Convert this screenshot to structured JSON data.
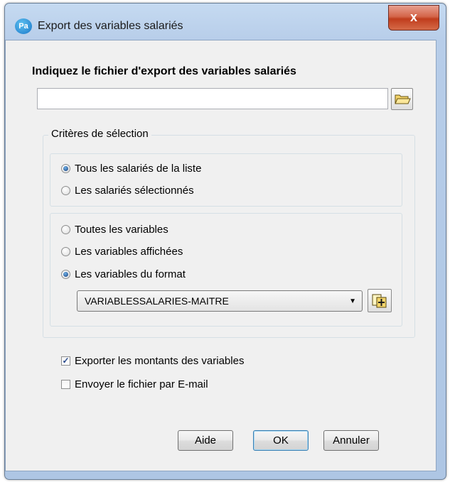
{
  "window": {
    "title": "Export des variables salariés",
    "app_icon_text": "Pa",
    "close_label": "x"
  },
  "file_section": {
    "heading": "Indiquez le fichier d'export des variables salariés",
    "file_value": "",
    "browse_icon": "folder-open-icon"
  },
  "criteria": {
    "label": "Critères de sélection",
    "employees": [
      {
        "label": "Tous les salariés de la liste",
        "selected": true
      },
      {
        "label": "Les salariés sélectionnés",
        "selected": false
      }
    ],
    "variables": [
      {
        "label": "Toutes les variables",
        "selected": false
      },
      {
        "label": "Les variables affichées",
        "selected": false
      },
      {
        "label": "Les variables du format",
        "selected": true
      }
    ],
    "format_select": {
      "value": "VARIABLESSALARIES-MAITRE",
      "icon": "format-properties-icon"
    }
  },
  "options": [
    {
      "label": "Exporter les montants des variables",
      "checked": true
    },
    {
      "label": "Envoyer le fichier par E-mail",
      "checked": false
    }
  ],
  "buttons": {
    "help": "Aide",
    "ok": "OK",
    "cancel": "Annuler"
  },
  "colors": {
    "title_bar": "#b7cde9",
    "close_button": "#c03d1d",
    "client_bg": "#f0f0f0"
  }
}
